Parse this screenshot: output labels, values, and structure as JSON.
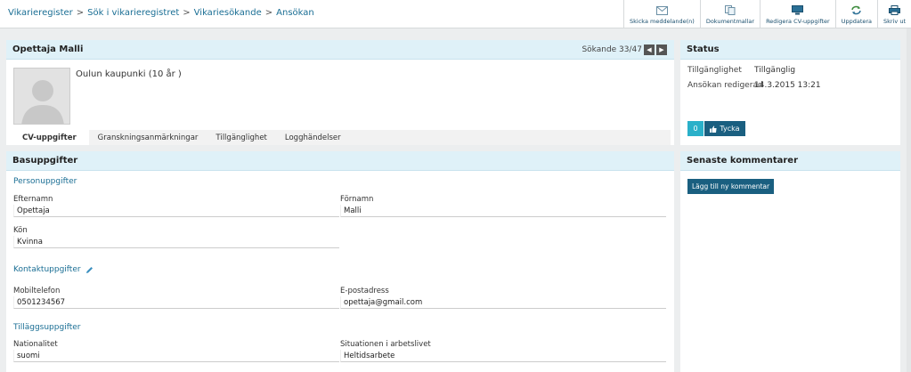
{
  "breadcrumb": [
    "Vikarieregister",
    "Sök i vikarieregistret",
    "Vikariesökande",
    "Ansökan"
  ],
  "toolbar": {
    "send_message": "Skicka meddelande(n)",
    "templates": "Dokumentmallar",
    "edit_cv": "Redigera CV-uppgifter",
    "refresh": "Uppdatera",
    "print": "Skriv ut"
  },
  "profile": {
    "name": "Opettaja Malli",
    "pager": "Sökande 33/47",
    "location": "Oulun kaupunki (10 år )",
    "tabs": [
      "CV-uppgifter",
      "Granskningsanmärkningar",
      "Tillgänglighet",
      "Logghändelser"
    ]
  },
  "basic": {
    "title": "Basuppgifter",
    "personal_title": "Personuppgifter",
    "lastname_label": "Efternamn",
    "lastname": "Opettaja",
    "firstname_label": "Förnamn",
    "firstname": "Malli",
    "gender_label": "Kön",
    "gender": "Kvinna",
    "contact_title": "Kontaktuppgifter",
    "mobile_label": "Mobiltelefon",
    "mobile": "0501234567",
    "email_label": "E-postadress",
    "email": "opettaja@gmail.com",
    "extra_title": "Tilläggsuppgifter",
    "nationality_label": "Nationalitet",
    "nationality": "suomi",
    "work_label": "Situationen i arbetslivet",
    "work": "Heltidsarbete"
  },
  "status": {
    "title": "Status",
    "availability_label": "Tillgänglighet",
    "availability": "Tillgänglig",
    "edited_label": "Ansökan redigerad",
    "edited": "14.3.2015 13:21",
    "like_count": "0",
    "like_label": "Tycka"
  },
  "comments": {
    "title": "Senaste kommentarer",
    "add_label": "Lägg till ny kommentar"
  },
  "colors": {
    "accent": "#1a5f80",
    "link": "#1a6e94",
    "panel_header": "#dff1f8",
    "like_count": "#2ab0c9"
  }
}
